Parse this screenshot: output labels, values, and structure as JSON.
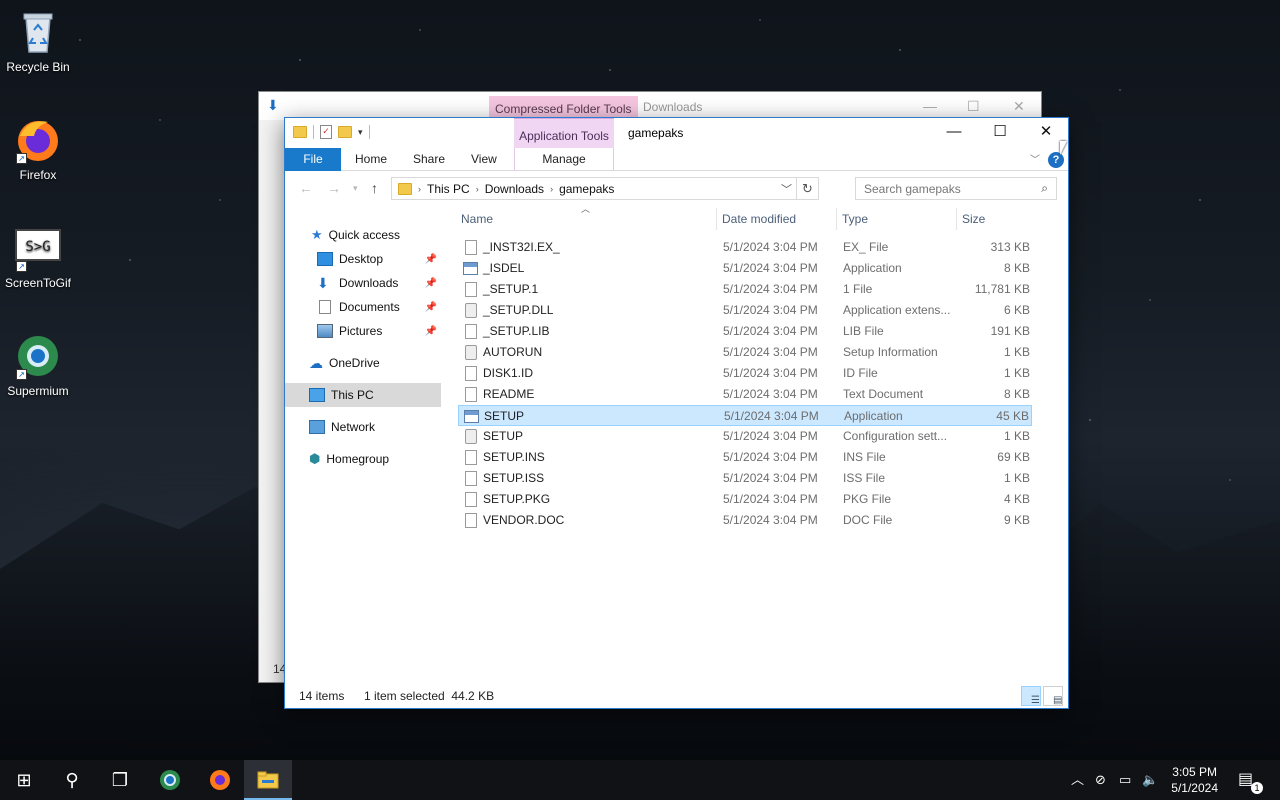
{
  "desktop": {
    "icons": [
      {
        "label": "Recycle Bin",
        "icon": "recycle-bin-icon"
      },
      {
        "label": "Firefox",
        "icon": "firefox-icon"
      },
      {
        "label": "ScreenToGif",
        "icon": "screentogif-icon",
        "logo_text": "S>G"
      },
      {
        "label": "Supermium",
        "icon": "supermium-icon"
      }
    ]
  },
  "back_window": {
    "context_tab": "Compressed Folder Tools",
    "title": "Downloads",
    "status_count": "14"
  },
  "window": {
    "context_tab": "Application Tools",
    "title": "gamepaks",
    "ribbon_tabs": {
      "file": "File",
      "home": "Home",
      "share": "Share",
      "view": "View",
      "manage": "Manage"
    },
    "help": "?",
    "breadcrumb": [
      "This PC",
      "Downloads",
      "gamepaks"
    ],
    "search_placeholder": "Search gamepaks",
    "nav": {
      "quick_access": "Quick access",
      "desktop": "Desktop",
      "downloads": "Downloads",
      "documents": "Documents",
      "pictures": "Pictures",
      "onedrive": "OneDrive",
      "this_pc": "This PC",
      "network": "Network",
      "homegroup": "Homegroup"
    },
    "columns": {
      "name": "Name",
      "date": "Date modified",
      "type": "Type",
      "size": "Size"
    },
    "files": [
      {
        "name": "_INST32I.EX_",
        "date": "5/1/2024 3:04 PM",
        "type": "EX_ File",
        "size": "313 KB",
        "icon": "file"
      },
      {
        "name": "_ISDEL",
        "date": "5/1/2024 3:04 PM",
        "type": "Application",
        "size": "8 KB",
        "icon": "app"
      },
      {
        "name": "_SETUP.1",
        "date": "5/1/2024 3:04 PM",
        "type": "1 File",
        "size": "11,781 KB",
        "icon": "file"
      },
      {
        "name": "_SETUP.DLL",
        "date": "5/1/2024 3:04 PM",
        "type": "Application extens...",
        "size": "6 KB",
        "icon": "cfg"
      },
      {
        "name": "_SETUP.LIB",
        "date": "5/1/2024 3:04 PM",
        "type": "LIB File",
        "size": "191 KB",
        "icon": "file"
      },
      {
        "name": "AUTORUN",
        "date": "5/1/2024 3:04 PM",
        "type": "Setup Information",
        "size": "1 KB",
        "icon": "cfg"
      },
      {
        "name": "DISK1.ID",
        "date": "5/1/2024 3:04 PM",
        "type": "ID File",
        "size": "1 KB",
        "icon": "file"
      },
      {
        "name": "README",
        "date": "5/1/2024 3:04 PM",
        "type": "Text Document",
        "size": "8 KB",
        "icon": "file"
      },
      {
        "name": "SETUP",
        "date": "5/1/2024 3:04 PM",
        "type": "Application",
        "size": "45 KB",
        "icon": "app",
        "selected": true
      },
      {
        "name": "SETUP",
        "date": "5/1/2024 3:04 PM",
        "type": "Configuration sett...",
        "size": "1 KB",
        "icon": "cfg"
      },
      {
        "name": "SETUP.INS",
        "date": "5/1/2024 3:04 PM",
        "type": "INS File",
        "size": "69 KB",
        "icon": "file"
      },
      {
        "name": "SETUP.ISS",
        "date": "5/1/2024 3:04 PM",
        "type": "ISS File",
        "size": "1 KB",
        "icon": "file"
      },
      {
        "name": "SETUP.PKG",
        "date": "5/1/2024 3:04 PM",
        "type": "PKG File",
        "size": "4 KB",
        "icon": "file"
      },
      {
        "name": "VENDOR.DOC",
        "date": "5/1/2024 3:04 PM",
        "type": "DOC File",
        "size": "9 KB",
        "icon": "file"
      }
    ],
    "status": {
      "count": "14 items",
      "selection": "1 item selected  44.2 KB"
    }
  },
  "taskbar": {
    "clock_time": "3:05 PM",
    "clock_date": "5/1/2024",
    "notification_count": "1"
  },
  "colors": {
    "accent": "#1979ca",
    "selection": "#cce8ff",
    "context_tab": "#f1d6f3"
  }
}
